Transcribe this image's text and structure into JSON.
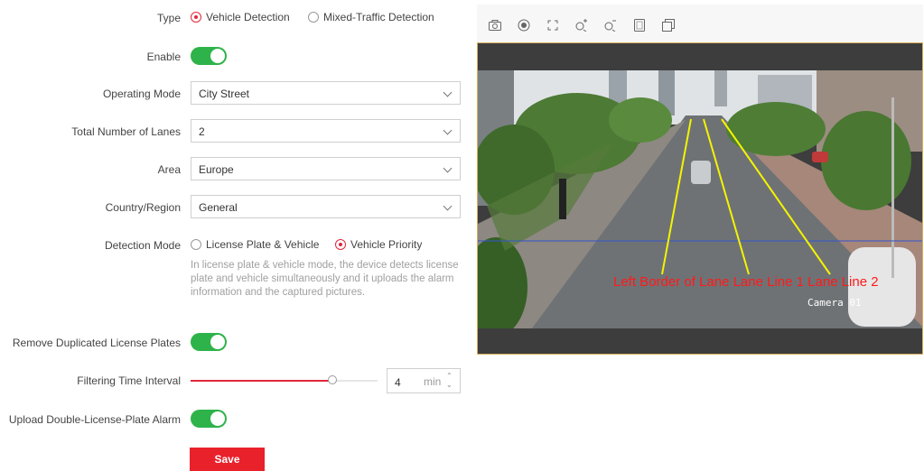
{
  "type": {
    "label": "Type",
    "options": [
      "Vehicle Detection",
      "Mixed-Traffic Detection"
    ],
    "selected": 0
  },
  "enable": {
    "label": "Enable",
    "on": true
  },
  "operating_mode": {
    "label": "Operating Mode",
    "value": "City Street"
  },
  "total_lanes": {
    "label": "Total Number of Lanes",
    "value": "2"
  },
  "area": {
    "label": "Area",
    "value": "Europe"
  },
  "country_region": {
    "label": "Country/Region",
    "value": "General"
  },
  "detection_mode": {
    "label": "Detection Mode",
    "options": [
      "License Plate & Vehicle",
      "Vehicle Priority"
    ],
    "selected": 1,
    "hint": "In license plate & vehicle mode, the device detects license plate and vehicle simultaneously and it uploads the alarm information and the captured pictures."
  },
  "remove_duplicated": {
    "label": "Remove Duplicated License Plates",
    "on": true
  },
  "filtering": {
    "label": "Filtering Time Interval",
    "value": "4",
    "unit": "min",
    "slider_fraction": 0.76
  },
  "double_plate": {
    "label": "Upload Double-License-Plate Alarm",
    "on": true
  },
  "save_label": "Save",
  "toolbar_icons": [
    "camera-icon",
    "record-icon",
    "fullscreen-icon",
    "zoom-in-icon",
    "zoom-out-icon",
    "copy-icon",
    "copy-icon"
  ],
  "video": {
    "camera_label": "Camera 01",
    "overlay_text": "Left Border of Lane Lane Line 1  Lane Line 2",
    "overlay_color": "#ff1a1a",
    "line_color": "#f4f400",
    "divider_color": "#3355cc"
  }
}
